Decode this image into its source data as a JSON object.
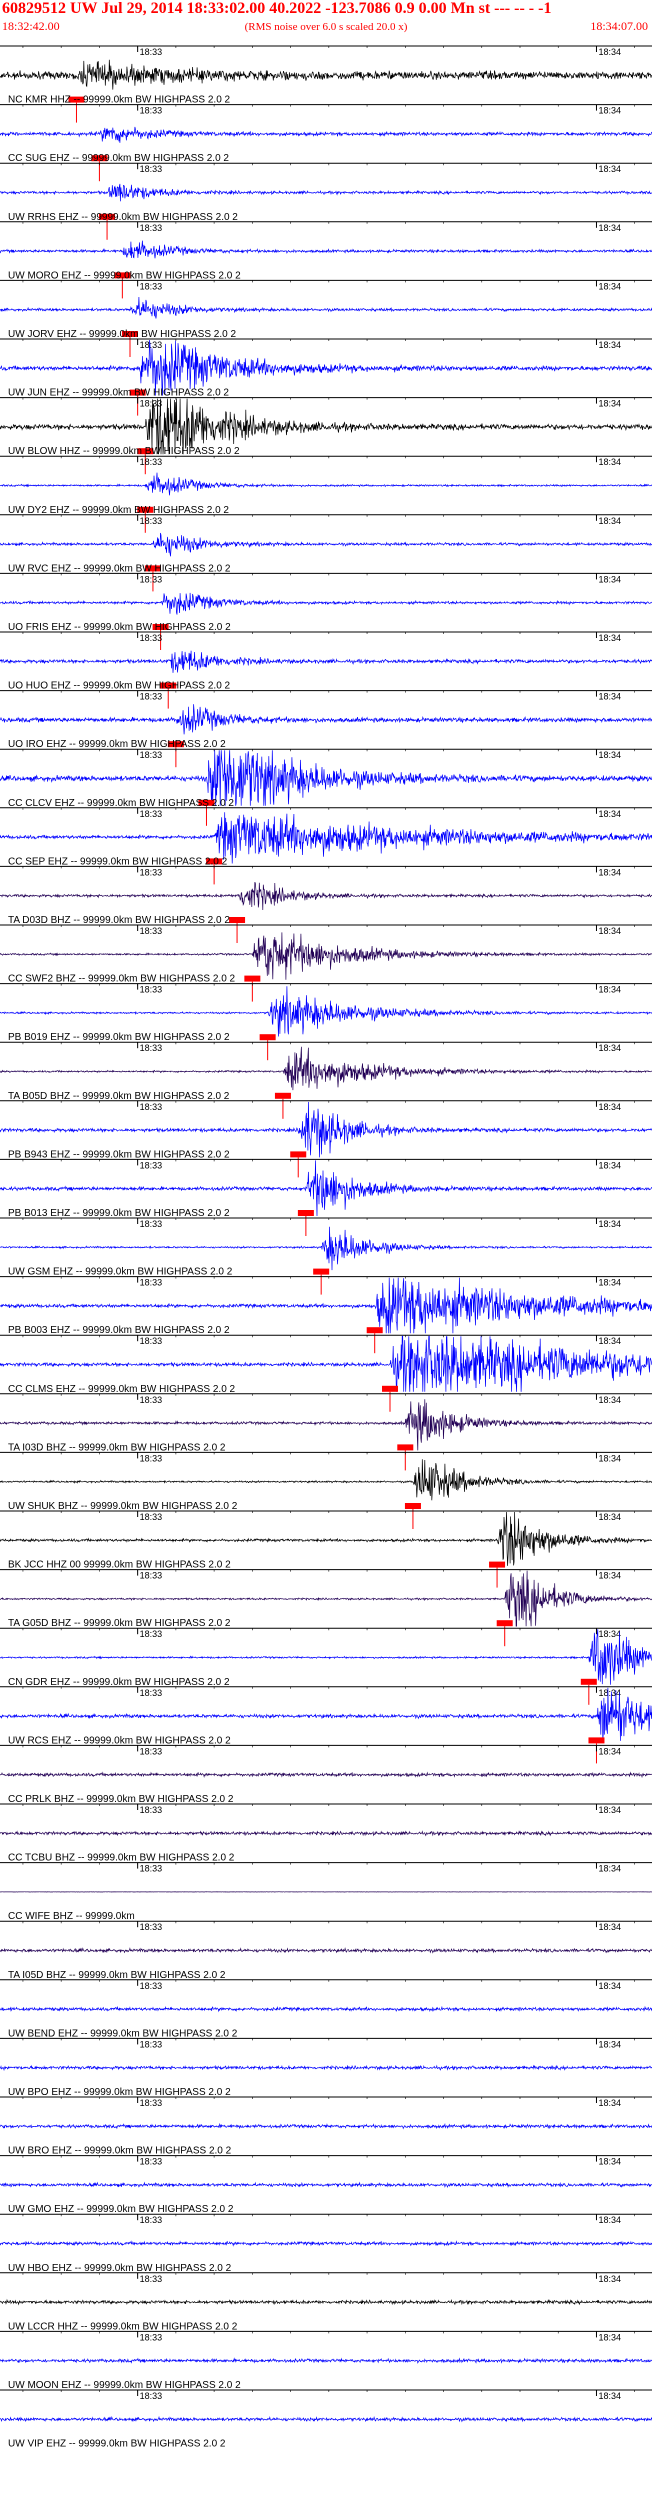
{
  "header": {
    "title": "60829512 UW Jul 29, 2014 18:33:02.00   40.2022 -123.7086  0.9 0.00 Mn st --- -- - -1",
    "start_time": "18:32:42.00",
    "rms_note": "(RMS noise over 6.0 s scaled 20.0 x)",
    "end_time": "18:34:07.00"
  },
  "chart_data": {
    "type": "line",
    "x_unit": "time (UTC)",
    "x_range": [
      "18:32:42.00",
      "18:34:07.00"
    ],
    "tick_labels": [
      "18:33",
      "18:34"
    ],
    "series": [
      {
        "name": "NC KMR HHZ -- 99999.0km BW  HIGHPASS  2.0  2",
        "color": "#000000",
        "pick": "18:32:52",
        "burst": [
          18,
          0.12,
          0.12,
          9
        ]
      },
      {
        "name": "CC SUG EHZ -- 99999.0km BW  HIGHPASS  2.0  2",
        "color": "#0000ff",
        "pick": "18:32:55",
        "burst": [
          20,
          0.05,
          0.05,
          4
        ]
      },
      {
        "name": "UW RRHS EHZ -- 99999.0km BW  HIGHPASS  2.0  2",
        "color": "#0000ff",
        "pick": "18:32:56",
        "burst": [
          21,
          0.05,
          0.05,
          3
        ]
      },
      {
        "name": "UW MORO EHZ -- 99999.0km BW  HIGHPASS  2.0  2",
        "color": "#0000ff",
        "pick": "18:32:58",
        "burst": [
          22,
          0.05,
          0.05,
          3
        ]
      },
      {
        "name": "UW JORV EHZ -- 99999.0km BW  HIGHPASS  2.0  2",
        "color": "#0000ff",
        "pick": "18:32:59",
        "burst": [
          23,
          0.05,
          0.05,
          3
        ]
      },
      {
        "name": "UW JUN EHZ -- 99999.0km BW  HIGHPASS  2.0  2",
        "color": "#0000ff",
        "pick": "18:33:00",
        "burst": [
          60,
          0.1,
          0.1,
          5
        ]
      },
      {
        "name": "UW BLOW HHZ -- 99999.0km BW  HIGHPASS  2.0  2",
        "color": "#000000",
        "pick": "18:33:01",
        "burst": [
          88,
          0.08,
          0.08,
          6
        ]
      },
      {
        "name": "UW DY2 EHZ -- 99999.0km BW  HIGHPASS  2.0  2",
        "color": "#0000ff",
        "pick": "18:33:01",
        "burst": [
          26,
          0.05,
          0.05,
          2
        ]
      },
      {
        "name": "UW RVC EHZ -- 99999.0km BW  HIGHPASS  2.0  2",
        "color": "#0000ff",
        "pick": "18:33:02",
        "burst": [
          27,
          0.05,
          0.05,
          3
        ]
      },
      {
        "name": "UO FRIS EHZ -- 99999.0km BW  HIGHPASS  2.0  2",
        "color": "#0000ff",
        "pick": "18:33:03",
        "burst": [
          28,
          0.05,
          0.05,
          3
        ]
      },
      {
        "name": "UO HUO EHZ -- 99999.0km BW  HIGHPASS  2.0  2",
        "color": "#0000ff",
        "pick": "18:33:04",
        "burst": [
          28,
          0.05,
          0.05,
          4
        ]
      },
      {
        "name": "UO IRO EHZ -- 99999.0km BW  HIGHPASS  2.0  2",
        "color": "#0000ff",
        "pick": "18:33:05",
        "burst": [
          30,
          0.05,
          0.05,
          5
        ]
      },
      {
        "name": "CC CLCV EHZ -- 99999.0km BW  HIGHPASS  2.0  2",
        "color": "#0000ff",
        "pick": "18:33:09",
        "burst": [
          90,
          0.1,
          0.1,
          6
        ]
      },
      {
        "name": "CC SEP EHZ -- 99999.0km BW  HIGHPASS  2.0  2",
        "color": "#0000ff",
        "pick": "18:33:10",
        "burst": [
          40,
          0.25,
          0.25,
          4
        ]
      },
      {
        "name": "TA D03D BHZ -- 99999.0km BW  HIGHPASS  2.0  2",
        "color": "#220055",
        "pick": "18:33:13",
        "burst": [
          33,
          0.05,
          0.05,
          3
        ]
      },
      {
        "name": "CC SWF2 BHZ -- 99999.0km BW  HIGHPASS  2.0  2",
        "color": "#220055",
        "pick": "18:33:15",
        "burst": [
          50,
          0.1,
          0.1,
          2
        ]
      },
      {
        "name": "PB B019 EHZ -- 99999.0km BW  HIGHPASS  2.0  2",
        "color": "#0000ff",
        "pick": "18:33:17",
        "burst": [
          40,
          0.1,
          0.1,
          2
        ]
      },
      {
        "name": "TA B05D BHZ -- 99999.0km BW  HIGHPASS  2.0  2",
        "color": "#220055",
        "pick": "18:33:19",
        "burst": [
          40,
          0.1,
          0.1,
          2
        ]
      },
      {
        "name": "PB B943 EHZ -- 99999.0km BW  HIGHPASS  2.0  2",
        "color": "#0000ff",
        "pick": "18:33:21",
        "burst": [
          66,
          0.05,
          0.05,
          4
        ]
      },
      {
        "name": "PB B013 EHZ -- 99999.0km BW  HIGHPASS  2.0  2",
        "color": "#0000ff",
        "pick": "18:33:22",
        "burst": [
          66,
          0.05,
          0.05,
          4
        ]
      },
      {
        "name": "UW GSM EHZ -- 99999.0km BW  HIGHPASS  2.0  2",
        "color": "#0000ff",
        "pick": "18:33:24",
        "burst": [
          47,
          0.05,
          0.05,
          2
        ]
      },
      {
        "name": "PB B003 EHZ -- 99999.0km BW  HIGHPASS  2.0  2",
        "color": "#0000ff",
        "pick": "18:33:31",
        "burst": [
          55,
          0.05,
          0.2,
          4
        ]
      },
      {
        "name": "CC CLMS EHZ -- 99999.0km BW  HIGHPASS  2.0  2",
        "color": "#0000ff",
        "pick": "18:33:33",
        "burst": [
          55,
          0.05,
          0.3,
          4
        ]
      },
      {
        "name": "TA I03D BHZ -- 99999.0km BW  HIGHPASS  2.0  2",
        "color": "#220055",
        "pick": "18:33:35",
        "burst": [
          57,
          0.05,
          0.05,
          3
        ]
      },
      {
        "name": "UW SHUK BHZ -- 99999.0km BW  HIGHPASS  2.0  2",
        "color": "#000000",
        "pick": "18:33:36",
        "burst": [
          58,
          0.05,
          0.05,
          2
        ]
      },
      {
        "name": "BK JCC HHZ 00 99999.0km BW  HIGHPASS  2.0  2",
        "color": "#000000",
        "pick": "18:33:47",
        "burst": [
          71,
          0.05,
          0.05,
          3
        ]
      },
      {
        "name": "TA G05D BHZ -- 99999.0km BW  HIGHPASS  2.0  2",
        "color": "#220055",
        "pick": "18:33:48",
        "burst": [
          73,
          0.05,
          0.05,
          2
        ]
      },
      {
        "name": "CN GDR EHZ -- 99999.0km BW  HIGHPASS  2.0  2",
        "color": "#0000ff",
        "pick": "18:33:59",
        "burst": [
          82,
          0.05,
          0.05,
          2
        ]
      },
      {
        "name": "UW RCS EHZ -- 99999.0km BW  HIGHPASS  2.0  2",
        "color": "#0000ff",
        "pick": "18:34:00",
        "burst": [
          84,
          0.05,
          0.05,
          4
        ]
      },
      {
        "name": "CC PRLK BHZ -- 99999.0km BW  HIGHPASS  2.0  2",
        "color": "#220055"
      },
      {
        "name": "CC TCBU BHZ -- 99999.0km BW  HIGHPASS  2.0  2",
        "color": "#220055"
      },
      {
        "name": "CC WIFE BHZ -- 99999.0km",
        "color": "#220055",
        "flat": true
      },
      {
        "name": "TA I05D BHZ -- 99999.0km BW  HIGHPASS  2.0  2",
        "color": "#220055"
      },
      {
        "name": "UW BEND EHZ -- 99999.0km BW  HIGHPASS  2.0  2",
        "color": "#0000ff"
      },
      {
        "name": "UW BPO EHZ -- 99999.0km BW  HIGHPASS  2.0  2",
        "color": "#0000ff"
      },
      {
        "name": "UW BRO EHZ -- 99999.0km BW  HIGHPASS  2.0  2",
        "color": "#0000ff"
      },
      {
        "name": "UW GMO EHZ -- 99999.0km BW  HIGHPASS  2.0  2",
        "color": "#0000ff"
      },
      {
        "name": "UW HBO EHZ -- 99999.0km BW  HIGHPASS  2.0  2",
        "color": "#0000ff"
      },
      {
        "name": "UW LCCR HHZ -- 99999.0km BW  HIGHPASS  2.0  2",
        "color": "#000000"
      },
      {
        "name": "UW MOON EHZ -- 99999.0km BW  HIGHPASS  2.0  2",
        "color": "#0000ff"
      },
      {
        "name": "UW VIP EHZ -- 99999.0km BW  HIGHPASS  2.0  2",
        "color": "#0000ff"
      }
    ],
    "grid": false,
    "legend": "none"
  },
  "colors": {
    "header_text": "#ff0000",
    "pick_marker": "#ff0000",
    "axis": "#000000"
  }
}
